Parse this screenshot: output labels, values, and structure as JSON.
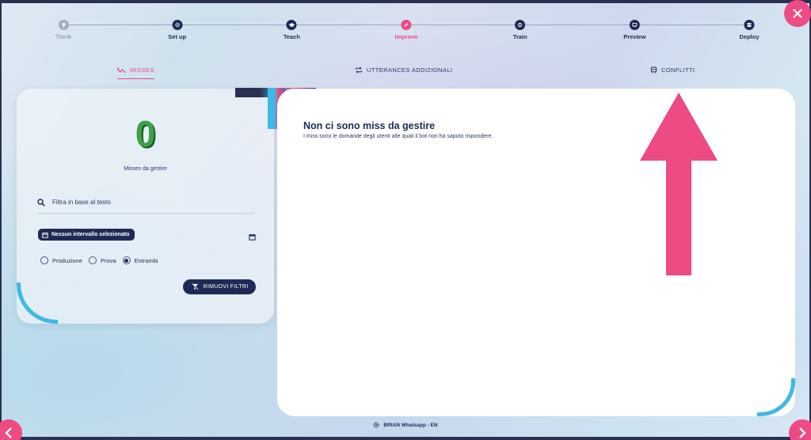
{
  "stepper": {
    "steps": [
      {
        "label": "Think",
        "state": "done",
        "icon": "lightbulb-icon"
      },
      {
        "label": "Set up",
        "state": "todo",
        "icon": "gear-icon"
      },
      {
        "label": "Teach",
        "state": "todo",
        "icon": "graduation-cap-icon"
      },
      {
        "label": "Improve",
        "state": "active",
        "icon": "pencil-icon"
      },
      {
        "label": "Train",
        "state": "todo",
        "icon": "brain-icon"
      },
      {
        "label": "Preview",
        "state": "todo",
        "icon": "monitor-icon"
      },
      {
        "label": "Deploy",
        "state": "todo",
        "icon": "server-icon"
      }
    ]
  },
  "tabs": {
    "misses": "MISSES",
    "utterances": "UTTERANCES ADDIZIONALI",
    "conflicts": "CONFLITTI"
  },
  "filters": {
    "count": "0",
    "count_label": "Misses da gestire",
    "search_placeholder": "Filtra in base al testo",
    "date_chip": "Nessun intervallo selezionato",
    "radio_options": [
      "Produzione",
      "Prova",
      "Entrambi"
    ],
    "radio_selected": "Entrambi",
    "remove_button": "RIMUOVI FILTRI"
  },
  "empty_state": {
    "title": "Non ci sono miss da gestire",
    "subtitle": "I miss sono le domande degli utenti alle quali il bot non ha saputo rispondere."
  },
  "footer": {
    "bot_name": "BRIAN Whatsapp - EN"
  },
  "colors": {
    "accent": "#ee4a84",
    "navy": "#1e2a55",
    "count_green": "#3aa24a",
    "arc_blue": "#3fb8e4"
  }
}
